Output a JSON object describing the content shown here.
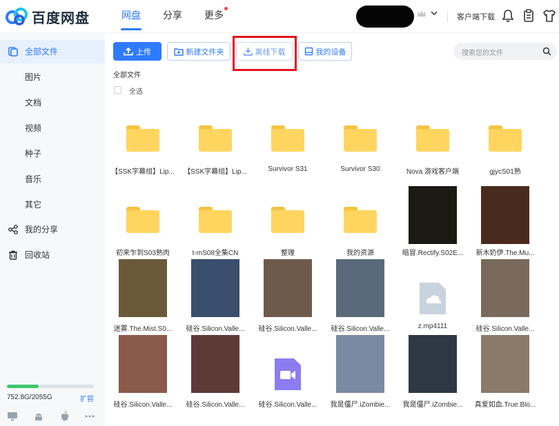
{
  "app": {
    "logo_text": "百度网盘"
  },
  "nav": {
    "items": [
      "网盘",
      "分享",
      "更多"
    ],
    "active": 0
  },
  "header": {
    "client_download": "客户端下载"
  },
  "sidebar": {
    "items": [
      "全部文件",
      "图片",
      "文档",
      "视频",
      "种子",
      "音乐",
      "其它",
      "我的分享",
      "回收站"
    ],
    "active": 0,
    "quota_text": "752.8G/2055G",
    "quota_fraction": 0.366,
    "expand_label": "扩容"
  },
  "toolbar": {
    "upload": "上传",
    "new_folder": "新建文件夹",
    "offline_download": "离线下载",
    "my_devices": "我的设备"
  },
  "search": {
    "placeholder": "搜索您的文件"
  },
  "breadcrumb": "全部文件",
  "select_all": "全选",
  "files": [
    {
      "name": "【SSK字幕组】Lip...",
      "kind": "folder"
    },
    {
      "name": "【SSK字幕组】Lip...",
      "kind": "folder"
    },
    {
      "name": "Survivor S31",
      "kind": "folder"
    },
    {
      "name": "Survivor S30",
      "kind": "folder"
    },
    {
      "name": "Nova 游戏客户端",
      "kind": "folder"
    },
    {
      "name": "gjycS01熟",
      "kind": "folder"
    },
    {
      "name": "初来乍到S03熟肉",
      "kind": "folder"
    },
    {
      "name": "t-mS08全集CN",
      "kind": "folder"
    },
    {
      "name": "整理",
      "kind": "folder"
    },
    {
      "name": "我的资源",
      "kind": "folder"
    },
    {
      "name": "暗冒.Rectify.S02E...",
      "kind": "video",
      "color": "#1c1a14"
    },
    {
      "name": "新木奶伊.The.Mu...",
      "kind": "video",
      "color": "#4a2a1f"
    },
    {
      "name": "迷雾.The.Mist.S0...",
      "kind": "video",
      "color": "#6a5a3a"
    },
    {
      "name": "硅谷.Silicon.Valle...",
      "kind": "video",
      "color": "#3a4f6e"
    },
    {
      "name": "硅谷.Silicon.Valle...",
      "kind": "video",
      "color": "#6e5a4a"
    },
    {
      "name": "硅谷.Silicon.Valle...",
      "kind": "video",
      "color": "#5a6a7a"
    },
    {
      "name": "z.mp4111",
      "kind": "cloud-file"
    },
    {
      "name": "硅谷.Silicon.Valle...",
      "kind": "video",
      "color": "#7a6a5e"
    },
    {
      "name": "硅谷.Silicon.Valle...",
      "kind": "video",
      "color": "#8a5a4a"
    },
    {
      "name": "硅谷.Silicon.Valle...",
      "kind": "video",
      "color": "#5e3a36"
    },
    {
      "name": "硅谷.Silicon.Valle...",
      "kind": "video-file"
    },
    {
      "name": "我是僵尸.iZombie...",
      "kind": "video",
      "color": "#7a8aa0"
    },
    {
      "name": "我是僵尸.iZombie...",
      "kind": "video",
      "color": "#2e3844"
    },
    {
      "name": "真爱如血.True.Blo...",
      "kind": "video",
      "color": "#8a7a6a"
    }
  ],
  "colors": {
    "accent": "#2f7bff",
    "highlight": "#e3131b",
    "folder": "#ffd560",
    "quota": "#3ec56d"
  }
}
